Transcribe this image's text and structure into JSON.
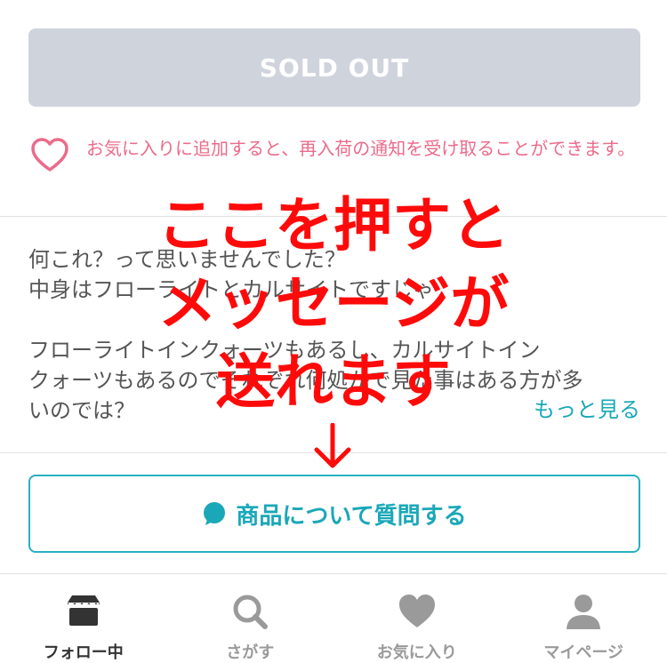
{
  "product": {
    "sold_out_label": "SOLD OUT",
    "favorite_notice": "お気に入りに追加すると、再入荷の通知を受け取ることができます。",
    "description_lines": [
      "何これ？って思いませんでした？",
      "中身はフローライトとカルサイトですじゃ",
      "",
      "フローライトインクォーツもあるし、カルサイトイン",
      "クォーツもあるのでそれぞれ何処かで見た事はある方が多",
      "いのでは？"
    ],
    "more_label": "もっと見る",
    "ask_button_label": "商品について質問する"
  },
  "annotation": {
    "lines": [
      "ここを押すと",
      "メッセージが",
      "送れます"
    ],
    "arrow": "↓",
    "color": "#ff0a0a"
  },
  "tabbar": {
    "tabs": [
      {
        "label": "フォロー中",
        "icon": "store-icon",
        "active": true
      },
      {
        "label": "さがす",
        "icon": "search-icon",
        "active": false
      },
      {
        "label": "お気に入り",
        "icon": "heart-icon",
        "active": false
      },
      {
        "label": "マイページ",
        "icon": "user-icon",
        "active": false
      }
    ]
  },
  "colors": {
    "accent": "#1aa8b8",
    "favorite": "#ec6b8a",
    "sold_out_bg": "#cfd3dc"
  }
}
